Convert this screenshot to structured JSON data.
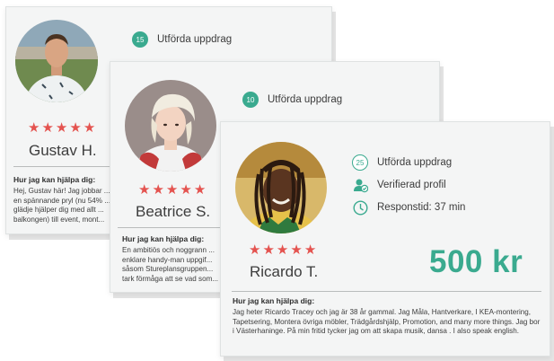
{
  "colors": {
    "accent": "#3aaa8f",
    "star": "#e4534f",
    "card": "#f4f5f5"
  },
  "cards": [
    {
      "name": "Gustav H.",
      "rating": 5,
      "tasks_count": "15",
      "tasks_label": "Utförda uppdrag",
      "help_heading": "Hur jag kan hjälpa dig:",
      "bio": "Hej, Gustav här! Jag jobbar ... en spännande pryl (nu 54% ... glädje hjälper dig med allt ... balkongen) till event, mont..."
    },
    {
      "name": "Beatrice S.",
      "rating": 5,
      "tasks_count": "10",
      "tasks_label": "Utförda uppdrag",
      "help_heading": "Hur jag kan hjälpa dig:",
      "bio": "En ambitiös och noggrann ... enklare handy-man uppgif... såsom Stureplansgruppen... tark förmåga att se vad som..."
    },
    {
      "name": "Ricardo T.",
      "rating": 5,
      "tasks_count": "25",
      "tasks_label": "Utförda uppdrag",
      "verified_label": "Verifierad profil",
      "verified_icon": "user-check-icon",
      "response_label": "Responstid: 37 min",
      "response_icon": "clock-icon",
      "price": "500 kr",
      "help_heading": "Hur jag kan hjälpa dig:",
      "bio": "Jag heter Ricardo Tracey och jag är 38 år gammal. Jag Måla, Hantverkare, I KEA-montering, Tapetsering, Montera övriga möbler, Trädgårdshjälp, Promotion, and many more things. Jag bor i Västerhaninge. På min fritid tycker jag om att skapa musik, dansa . I also speak english."
    }
  ]
}
